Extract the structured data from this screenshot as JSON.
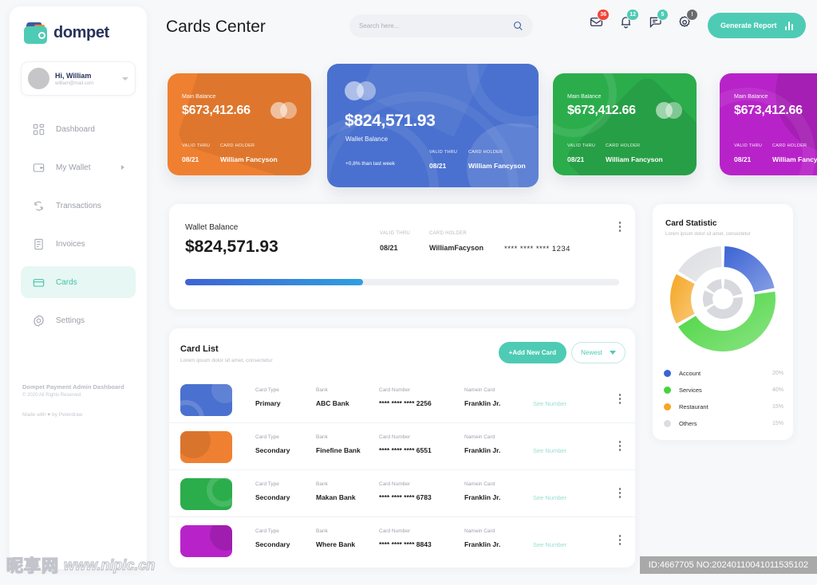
{
  "brand": {
    "name": "dompet",
    "logo_icon": "wallet-logo-icon",
    "accent": "#4ecbb4"
  },
  "profile": {
    "greeting": "Hi, William",
    "email": "william@mail.com",
    "avatar_icon": "avatar-icon",
    "caret_icon": "chevron-down-icon"
  },
  "sidebar": {
    "items": [
      {
        "label": "Dashboard",
        "icon": "dashboard-icon",
        "active": false,
        "has_arrow": false
      },
      {
        "label": "My Wallet",
        "icon": "wallet-icon",
        "active": false,
        "has_arrow": true
      },
      {
        "label": "Transactions",
        "icon": "transactions-icon",
        "active": false,
        "has_arrow": false
      },
      {
        "label": "Invoices",
        "icon": "invoices-icon",
        "active": false,
        "has_arrow": false
      },
      {
        "label": "Cards",
        "icon": "cards-icon",
        "active": true,
        "has_arrow": false
      },
      {
        "label": "Settings",
        "icon": "gear-icon",
        "active": false,
        "has_arrow": false
      }
    ],
    "footer": {
      "title": "Dompet Payment Admin Dashboard",
      "copyright": "© 2020 All Rights Reserved",
      "credit": "Made with ♥ by Peterdraw"
    }
  },
  "header": {
    "title": "Cards Center",
    "search": {
      "placeholder": "Search here...",
      "value": "",
      "icon": "search-icon"
    },
    "icons": [
      {
        "name": "mail-icon",
        "badge": "36",
        "badge_color": "#f0443a"
      },
      {
        "name": "bell-icon",
        "badge": "12",
        "badge_color": "#4ecbb4"
      },
      {
        "name": "message-icon",
        "badge": "5",
        "badge_color": "#4ecbb4"
      },
      {
        "name": "settings-alert-icon",
        "badge": "!",
        "badge_color": "#6c6c6e"
      }
    ],
    "generate_report": {
      "label": "Generate Report",
      "icon": "bar-chart-icon"
    }
  },
  "credit_cards": [
    {
      "label": "Main Balance",
      "amount": "$673,412.66",
      "valid_caption": "VALID THRU",
      "valid_value": "08/21",
      "holder_caption": "CARD HOLDER",
      "holder_value": "William Fancyson",
      "color": "#ef8031",
      "variant": "orange",
      "featured": false
    },
    {
      "label": "Wallet Balance",
      "amount": "$824,571.93",
      "trend": "+0,8% than last week",
      "valid_caption": "VALID THRU",
      "valid_value": "08/21",
      "holder_caption": "CARD HOLDER",
      "holder_value": "William Fancyson",
      "color": "#4a71cf",
      "variant": "blue",
      "featured": true
    },
    {
      "label": "Main Balance",
      "amount": "$673,412.66",
      "valid_caption": "VALID THRU",
      "valid_value": "08/21",
      "holder_caption": "CARD HOLDER",
      "holder_value": "William Fancyson",
      "color": "#2bad4c",
      "variant": "green",
      "featured": false
    },
    {
      "label": "Main Balance",
      "amount": "$673,412.66",
      "valid_caption": "VALID THRU",
      "valid_value": "08/21",
      "holder_caption": "CARD HOLDER",
      "holder_value": "William Fancyson",
      "color": "#b823c9",
      "variant": "purple",
      "featured": false
    }
  ],
  "wallet_panel": {
    "title": "Wallet Balance",
    "amount": "$824,571.93",
    "valid_caption": "VALID THRU",
    "valid_value": "08/21",
    "holder_caption": "CARD HOLDER",
    "holder_value": "WilliamFacyson",
    "card_number": "**** **** **** 1234",
    "progress_percent": 41,
    "menu_icon": "kebab-menu-icon"
  },
  "card_list": {
    "title": "Card List",
    "subtitle": "Lorem ipsum dolor sit amet, consectetur",
    "add_button": "+Add New Card",
    "sort_value": "Newest",
    "columns": {
      "type": "Card Type",
      "bank": "Bank",
      "number": "Card Number",
      "name": "Namein Card"
    },
    "see_number_label": "See Number",
    "rows": [
      {
        "type": "Primary",
        "bank": "ABC Bank",
        "number": "**** **** **** 2256",
        "name": "Franklin Jr.",
        "color": "#4a71cf"
      },
      {
        "type": "Secondary",
        "bank": "Finefine Bank",
        "number": "**** **** **** 6551",
        "name": "Franklin Jr.",
        "color": "#ef8031"
      },
      {
        "type": "Secondary",
        "bank": "Makan Bank",
        "number": "**** **** **** 6783",
        "name": "Franklin Jr.",
        "color": "#2bad4c"
      },
      {
        "type": "Secondary",
        "bank": "Where Bank",
        "number": "**** **** **** 8843",
        "name": "Franklin Jr.",
        "color": "#b823c9"
      }
    ]
  },
  "chart_data": {
    "type": "pie",
    "title": "Card Statistic",
    "subtitle": "Lorem ipsum dolor sit amet, consectetur",
    "categories": [
      "Account",
      "Services",
      "Restaurant",
      "Others"
    ],
    "values": [
      20,
      40,
      15,
      15
    ],
    "labels": [
      "20%",
      "40%",
      "15%",
      "15%"
    ],
    "colors": [
      "#3b63d4",
      "#46d43b",
      "#f5a623",
      "#dcdde1"
    ],
    "legend_position": "bottom",
    "donut": true
  },
  "watermark": {
    "cjk": "昵享网",
    "url": "www.nipic.cn",
    "id": "ID:4667705 NO:20240110041011535102"
  }
}
